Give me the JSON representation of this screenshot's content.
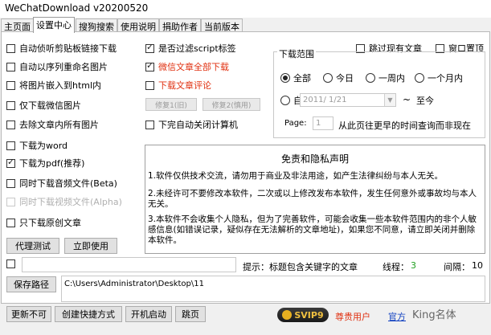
{
  "window": {
    "title": "WeChatDownload v20200520"
  },
  "tabs": [
    "主页面",
    "设置中心",
    "搜狗搜索",
    "使用说明",
    "捐助作者",
    "当前版本"
  ],
  "left_options": [
    {
      "label": "自动侦听剪贴板链接下载",
      "checked": false
    },
    {
      "label": "自动以序列重命名图片",
      "checked": false
    },
    {
      "label": "将图片嵌入到html内",
      "checked": false
    },
    {
      "label": "仅下载微信图片",
      "checked": false
    },
    {
      "label": "去除文章内所有图片",
      "checked": false
    },
    {
      "label": "下载为word",
      "checked": false
    },
    {
      "label": "下载为pdf(推荐)",
      "checked": true
    },
    {
      "label": "同时下载音频文件(Beta)",
      "checked": false
    },
    {
      "label": "同时下载视频文件(Alpha)",
      "checked": false,
      "disabled": true
    },
    {
      "label": "只下载原创文章",
      "checked": false
    }
  ],
  "middle_options": [
    {
      "label": "是否过滤script标签",
      "checked": true
    },
    {
      "label": "微信文章全部下载",
      "checked": true,
      "red": true
    },
    {
      "label": "下载文章评论",
      "checked": false,
      "red": true
    }
  ],
  "repair_buttons": {
    "r1": "修复1(旧)",
    "r2": "修复2(慎用)"
  },
  "auto_shutdown": "下完自动关闭计算机",
  "top_right": {
    "skip_existing": "跳过现有文章",
    "window_top": "窗口置顶"
  },
  "range": {
    "title": "下载范围",
    "options": [
      "全部",
      "今日",
      "一周内",
      "一个月内"
    ],
    "selected": "全部",
    "custom": "自定义",
    "date_value": "2011/ 1/21",
    "tilde": "~",
    "until_now": "至今",
    "page_label": "Page:",
    "page_value": "1",
    "page_hint": "从此页往更早的时间查询而非现在"
  },
  "buttons": {
    "proxy_test": "代理测试",
    "use_now": "立即使用"
  },
  "notice": {
    "title": "免责和隐私声明",
    "p1": "1.软件仅供技术交流，请勿用于商业及非法用途，如产生法律纠纷与本人无关。",
    "p2": "2.未经许可不要修改本软件，二次或以上修改发布本软件，发生任何意外或事故均与本人无关。",
    "p3": "3.本软件不会收集个人隐私，但为了完善软件，可能会收集一些本软件范围内的非个人敏感信息(如错误记录，疑似存在无法解析的文章地址)，如果您不同意，请立即关闭并删除本软件。"
  },
  "status": {
    "tip_label": "提示：标题包含关键字的文章",
    "threads_label": "线程：",
    "threads_value": "3",
    "interval_label": "间隔：",
    "interval_value": "10"
  },
  "save_path": {
    "button": "保存路径",
    "value": "C:\\Users\\Administrator\\Desktop\\11"
  },
  "footer_buttons": [
    "更新不可",
    "创建快捷方式",
    "开机启动",
    "跳页"
  ],
  "vip": {
    "label": "SVIP9",
    "user": "尊贵用户",
    "link": "官方"
  },
  "watermark": "King名体",
  "colors": {
    "red": "#e03010",
    "green": "#20a020",
    "link": "#1040c0"
  }
}
